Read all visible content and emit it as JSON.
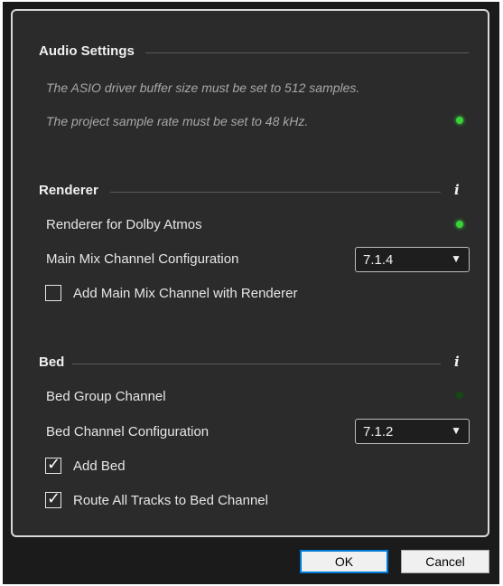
{
  "audio_settings": {
    "title": "Audio Settings",
    "note_buffer": "The ASIO driver buffer size must be set to 512 samples.",
    "note_sample_rate": "The project sample rate must be set to 48 kHz.",
    "sample_rate_status": "on"
  },
  "renderer": {
    "title": "Renderer",
    "info_glyph": "i",
    "renderer_label": "Renderer for Dolby Atmos",
    "renderer_status": "on",
    "main_mix_label": "Main Mix Channel Configuration",
    "main_mix_value": "7.1.4",
    "add_main_mix_label": "Add Main Mix Channel with Renderer",
    "add_main_mix_checked": false
  },
  "bed": {
    "title": "Bed",
    "info_glyph": "i",
    "bed_group_label": "Bed Group Channel",
    "bed_group_status": "off",
    "bed_config_label": "Bed Channel Configuration",
    "bed_config_value": "7.1.2",
    "add_bed_label": "Add Bed",
    "add_bed_checked": true,
    "route_all_label": "Route All Tracks to Bed Channel",
    "route_all_checked": true
  },
  "checkmark_glyph": "✓",
  "dropdown_arrow_glyph": "▼",
  "buttons": {
    "ok": "OK",
    "cancel": "Cancel"
  },
  "colors": {
    "status_on": "#37d337",
    "status_off": "#124a12",
    "default_button_border": "#0078d7"
  }
}
